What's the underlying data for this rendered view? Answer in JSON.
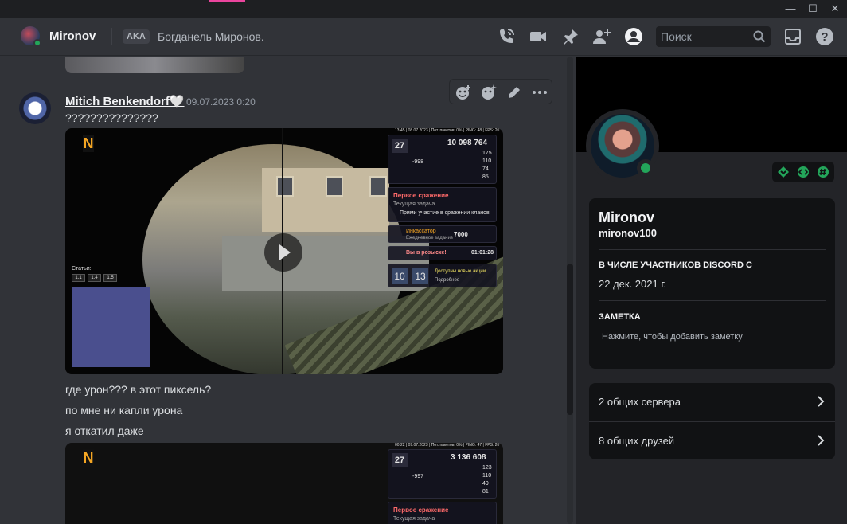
{
  "header": {
    "name": "Mironov",
    "aka_badge": "AKA",
    "aka_name": "Богданель Миронов.",
    "search_placeholder": "Поиск"
  },
  "message": {
    "author": "Mitich Benkendorf🤍",
    "timestamp": "09.07.2023 0:20",
    "lines": [
      "???????????????",
      "где урон??? в этот пиксель?",
      "по мне ни капли урона",
      "я откатил даже"
    ]
  },
  "video1": {
    "hud_top": "13:45 | 08.07.2023 | Пот. пакетов: 0% | PING: 48 | FPS: 20",
    "level": "27",
    "money": "10 098 764",
    "debt": "-998",
    "stats": [
      "175",
      "110",
      "74",
      "85"
    ],
    "task_title": "Первое сражение",
    "task_sub": "Текущая задача",
    "task_text": "Прими участие в сражении кланов",
    "quest_name": "Инкассатор",
    "quest_sub": "Ежедневное задание",
    "quest_amount": "7000",
    "wanted": "Вы в розыске!",
    "wanted_timer": "01:01:28",
    "clock_h": "10",
    "clock_m": "13",
    "promo": "Доступны новые акции",
    "promo_sub": "Подробнее",
    "stats_label": "Статьи:",
    "stat_chips": [
      "1.1",
      "1.4",
      "1.5"
    ]
  },
  "video2": {
    "hud_top": "00:22 | 09.07.2023 | Пот. пакетов: 0% | PING: 47 | FPS: 20",
    "level": "27",
    "money": "3 136 608",
    "debt": "-997",
    "stats": [
      "123",
      "110",
      "49",
      "81"
    ],
    "task_title": "Первое сражение",
    "task_sub": "Текущая задача"
  },
  "profile": {
    "display_name": "Mironov",
    "username": "mironov100",
    "member_since_label": "В ЧИСЛЕ УЧАСТНИКОВ DISCORD С",
    "member_since": "22 дек. 2021 г.",
    "note_label": "ЗАМЕТКА",
    "note_placeholder": "Нажмите, чтобы добавить заметку",
    "mutual_servers": "2 общих сервера",
    "mutual_friends": "8 общих друзей"
  },
  "colors": {
    "background": "#313338",
    "sidebar": "#232428",
    "online": "#23a55a",
    "accent": "#eb459e"
  }
}
